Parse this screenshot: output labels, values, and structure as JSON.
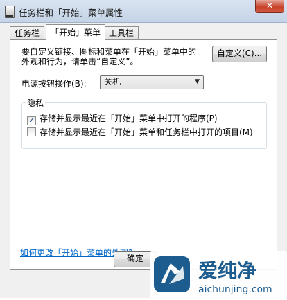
{
  "window": {
    "title": "任务栏和「开始」菜单属性",
    "close_label": "✕"
  },
  "tabs": [
    {
      "label": "任务栏",
      "active": false
    },
    {
      "label": "「开始」菜单",
      "active": true
    },
    {
      "label": "工具栏",
      "active": false
    }
  ],
  "start_menu": {
    "description_line1": "要自定义链接、图标和菜单在「开始」菜单中的",
    "description_line2": "外观和行为，请单击“自定义”。",
    "customize_button": "自定义(C)...",
    "power_label": "电源按钮操作(B):",
    "power_value": "关机"
  },
  "privacy": {
    "title": "隐私",
    "options": [
      {
        "label": "存储并显示最近在「开始」菜单中打开的程序(P)",
        "checked": true
      },
      {
        "label": "存储并显示最近在「开始」菜单和任务栏中打开的项目(M)",
        "checked": false
      }
    ]
  },
  "help_link": "如何更改「开始」菜单的外观?",
  "footer": {
    "ok_label": "确定"
  },
  "watermark": {
    "brand": "爱纯净",
    "url": "aichunjing.com"
  }
}
